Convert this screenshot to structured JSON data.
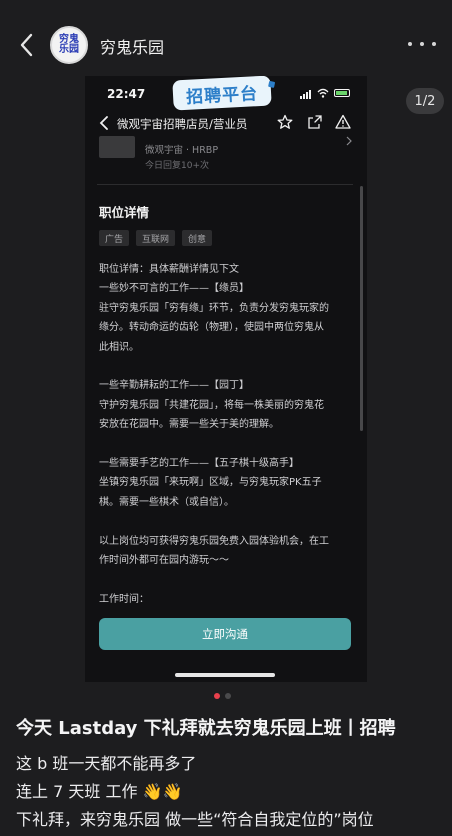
{
  "header": {
    "account_name": "穷鬼乐园",
    "avatar_line1": "穷鬼",
    "avatar_line2": "乐园"
  },
  "media": {
    "counter": "1/2",
    "phone_time": "22:47",
    "stamp_text": "招聘平台",
    "nav_title": "微观宇宙招聘店员/营业员",
    "context_sub": "微观宇宙 · HRBP",
    "context_reply": "今日回复10+次",
    "section_title": "职位详情",
    "tags": [
      "广告",
      "互联网",
      "创意"
    ],
    "description_lines": [
      "职位详情：具体薪酬详情见下文",
      "一些妙不可言的工作——【缘员】",
      "驻守穷鬼乐园「穷有缘」环节，负责分发穷鬼玩家的",
      "缘分。转动命运的齿轮（物理），使园中两位穷鬼从",
      "此相识。",
      "",
      "一些辛勤耕耘的工作——【园丁】",
      "守护穷鬼乐园「共建花园」，将每一株美丽的穷鬼花",
      "安放在花园中。需要一些关于美的理解。",
      "",
      "一些需要手艺的工作——【五子棋十级高手】",
      "坐镇穷鬼乐园「来玩啊」区域，与穷鬼玩家PK五子",
      "棋。需要一些棋术（或自信）。",
      "",
      "以上岗位均可获得穷鬼乐园免费入园体验机会，在工",
      "作时间外都可在园内游玩～～",
      "",
      "工作时间："
    ],
    "cta_label": "立即沟通"
  },
  "post": {
    "title": "今天 Lastday 下礼拜就去穷鬼乐园上班丨招聘",
    "line1": "这 b 班一天都不能再多了",
    "line2": "连上 7 天班 工作 👋👋",
    "line3": "下礼拜，来穷鬼乐园 做一些“符合自我定位的”岗位"
  },
  "colors": {
    "background": "#1d1d1f",
    "cta": "#4aa0a2",
    "active_dot": "#e8404c"
  },
  "icons": [
    "back-icon",
    "more-icon",
    "star-icon",
    "share-icon",
    "report-icon",
    "chevron-right-icon"
  ]
}
